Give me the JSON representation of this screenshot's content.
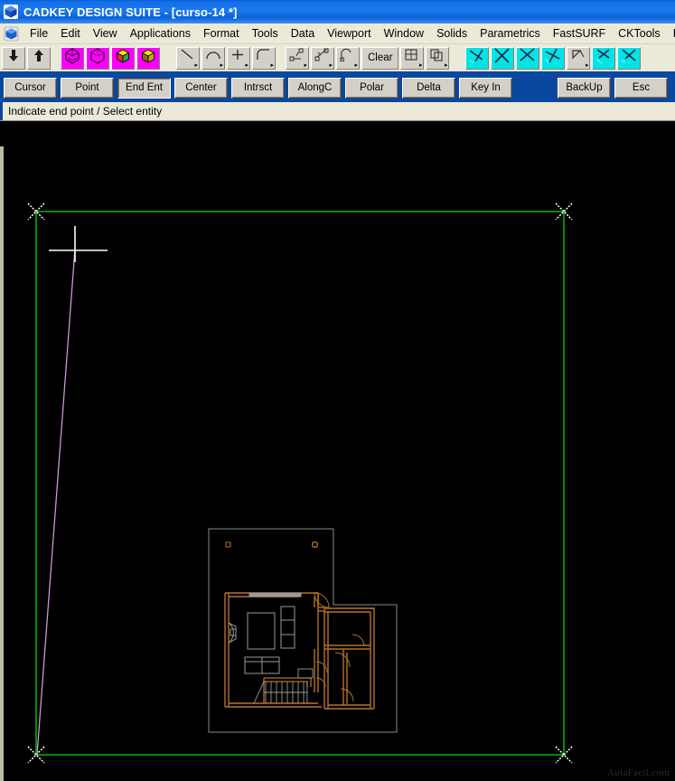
{
  "window": {
    "title": "CADKEY DESIGN SUITE - [curso-14 *]",
    "logo_icon": "cadkey-cube-icon"
  },
  "menubar": {
    "icon": "cadkey-cube-icon",
    "items": [
      {
        "label": "File"
      },
      {
        "label": "Edit"
      },
      {
        "label": "View"
      },
      {
        "label": "Applications"
      },
      {
        "label": "Format"
      },
      {
        "label": "Tools"
      },
      {
        "label": "Data"
      },
      {
        "label": "Viewport"
      },
      {
        "label": "Window"
      },
      {
        "label": "Solids"
      },
      {
        "label": "Parametrics"
      },
      {
        "label": "FastSURF"
      },
      {
        "label": "CKTools"
      },
      {
        "label": "Help"
      }
    ]
  },
  "toolbar": {
    "clear_label": "Clear",
    "buttons": [
      {
        "name": "move-down-button",
        "icon": "arrow-down-icon",
        "style": "plain"
      },
      {
        "name": "move-up-button",
        "icon": "arrow-up-icon",
        "style": "plain"
      },
      {
        "name": "wireframe-view-button",
        "icon": "wireframe-cube-icon",
        "style": "magenta"
      },
      {
        "name": "hidden-line-view-button",
        "icon": "wireframe-cube-icon",
        "style": "magenta"
      },
      {
        "name": "shaded-view-button",
        "icon": "shaded-cube-icon",
        "style": "magenta"
      },
      {
        "name": "render-view-button",
        "icon": "solid-cube-icon",
        "style": "magenta"
      },
      {
        "name": "line-tool-button",
        "icon": "line-icon",
        "style": "plain"
      },
      {
        "name": "arc-tool-button",
        "icon": "arc-icon",
        "style": "plain"
      },
      {
        "name": "point-tool-button",
        "icon": "point-cross-icon",
        "style": "plain"
      },
      {
        "name": "fillet-tool-button",
        "icon": "fillet-icon",
        "style": "plain"
      },
      {
        "name": "dimension-linear-button",
        "icon": "linear-dimension-icon",
        "style": "plain"
      },
      {
        "name": "dimension-angular-button",
        "icon": "angular-dimension-icon",
        "style": "plain"
      },
      {
        "name": "leader-note-button",
        "icon": "leader-note-icon",
        "style": "plain"
      },
      {
        "name": "clear-button",
        "icon": "text-label",
        "style": "wide"
      },
      {
        "name": "crosshatch-button",
        "icon": "crosshatch-icon",
        "style": "plain"
      },
      {
        "name": "copy-entity-button",
        "icon": "copy-entity-icon",
        "style": "plain"
      },
      {
        "name": "trim-divide-button",
        "icon": "trim-divide-icon",
        "style": "cyan"
      },
      {
        "name": "trim-first-button",
        "icon": "trim-x-icon",
        "style": "cyan"
      },
      {
        "name": "trim-both-button",
        "icon": "trim-x-icon",
        "style": "cyan"
      },
      {
        "name": "trim-double-button",
        "icon": "trim-divide-icon",
        "style": "cyan"
      },
      {
        "name": "break-entity-button",
        "icon": "break-polygon-icon",
        "style": "plain"
      },
      {
        "name": "extend-entity-button",
        "icon": "extend-x-icon",
        "style": "cyan"
      },
      {
        "name": "trim-corner-button",
        "icon": "trim-x-icon",
        "style": "cyan"
      }
    ]
  },
  "command_bar": {
    "buttons": [
      {
        "label": "Cursor",
        "active": false
      },
      {
        "label": "Point",
        "active": false
      },
      {
        "label": "End Ent",
        "active": true
      },
      {
        "label": "Center",
        "active": false
      },
      {
        "label": "Intrsct",
        "active": false
      },
      {
        "label": "AlongC",
        "active": false
      },
      {
        "label": "Polar",
        "active": false
      },
      {
        "label": "Delta",
        "active": false
      },
      {
        "label": "Key In",
        "active": false
      }
    ],
    "right_buttons": [
      {
        "label": "BackUp"
      },
      {
        "label": "Esc"
      }
    ]
  },
  "status": {
    "prompt": "Indicate end point / Select entity"
  },
  "canvas": {
    "background_color": "#000000",
    "border_color": "#00b000",
    "marker_color": "#ffffff",
    "cursor_color": "#ffffff",
    "rubber_line_color": "#c79ad0",
    "wall_color": "#b5722a",
    "furniture_color": "#9a9a9a",
    "outline_color": "#8a8a8a",
    "watermark": "AulaFacil.com"
  }
}
